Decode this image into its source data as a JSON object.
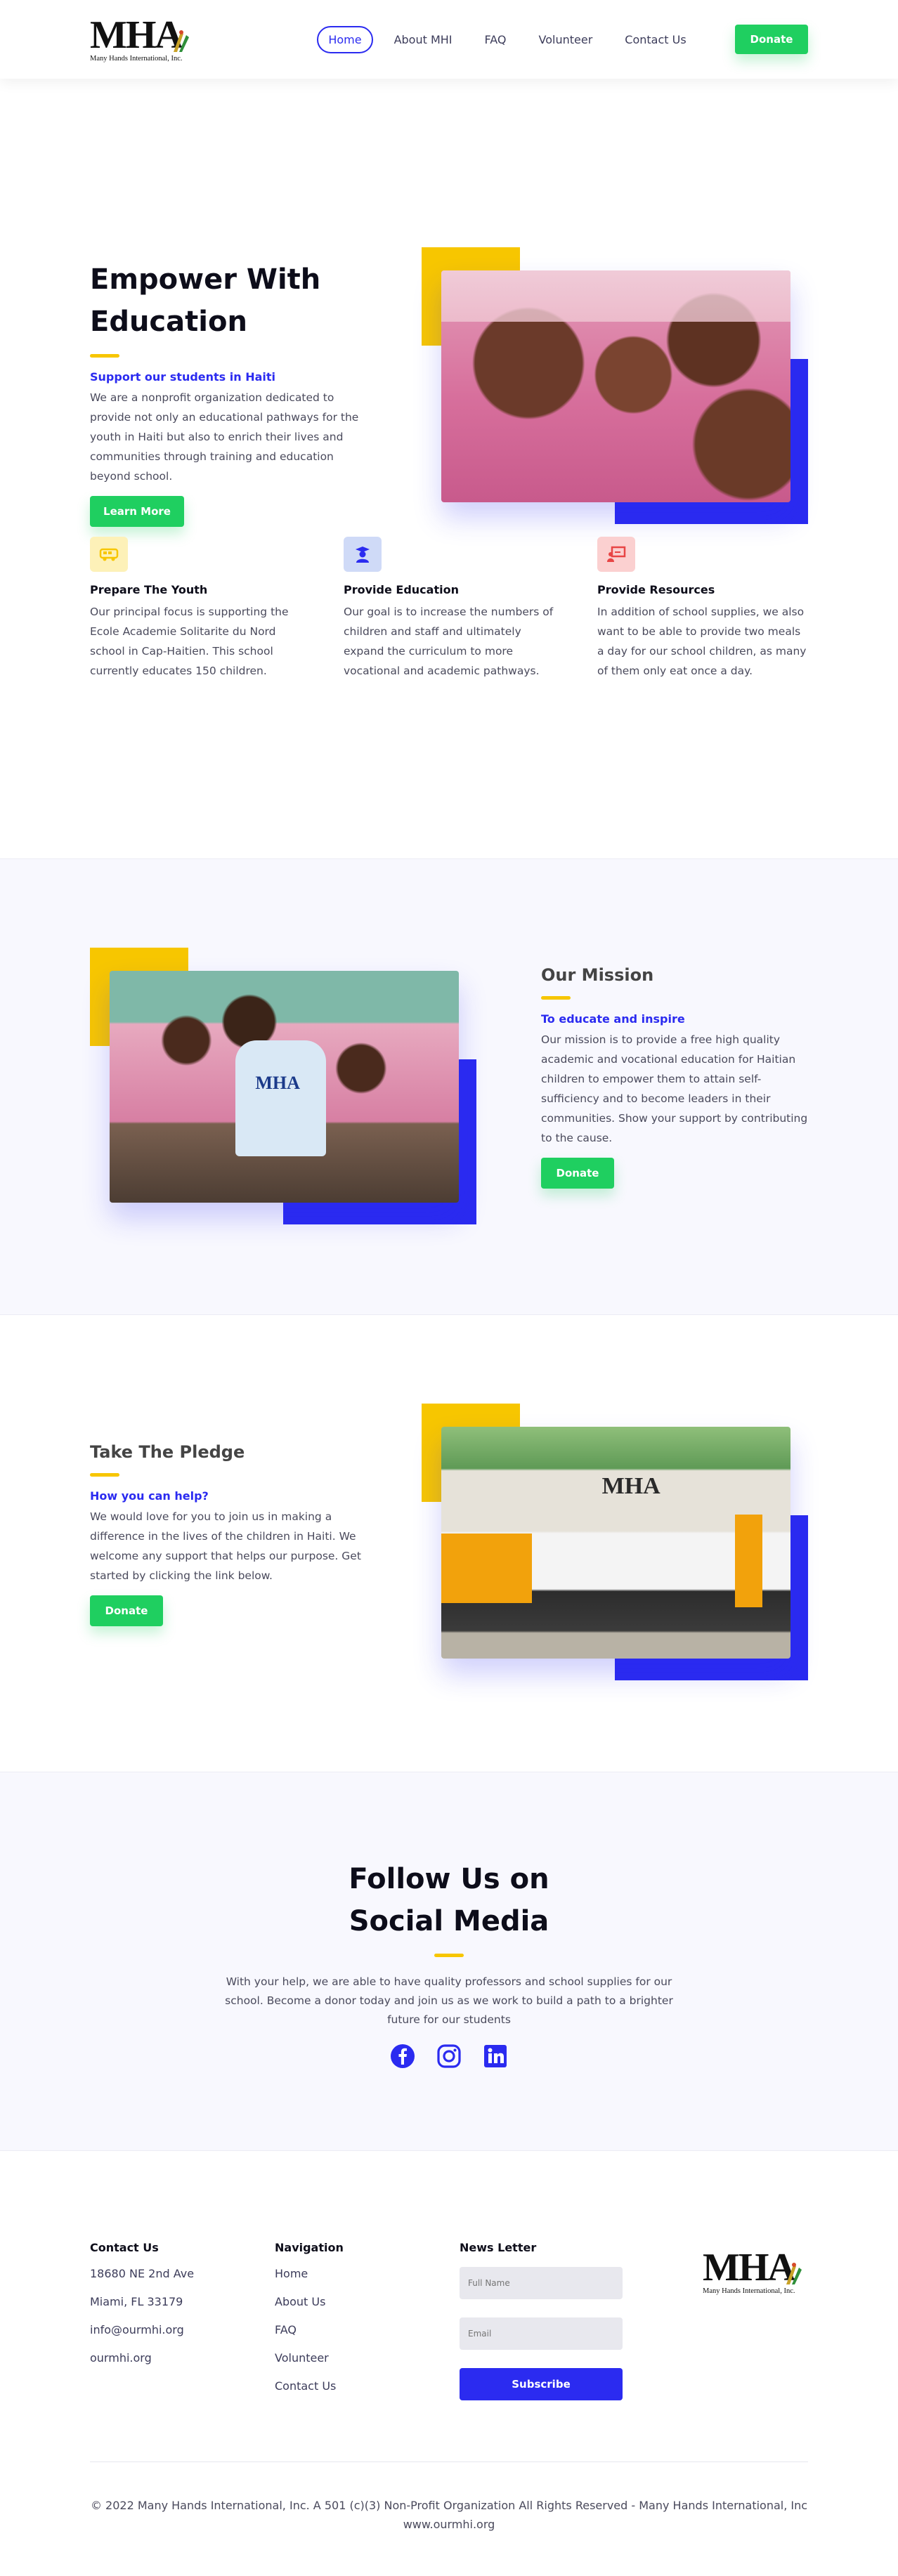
{
  "brand": {
    "logo_text": "MHA",
    "logo_sub": "Many Hands International, Inc."
  },
  "nav": [
    {
      "label": "Home",
      "active": true
    },
    {
      "label": "About MHI"
    },
    {
      "label": "FAQ"
    },
    {
      "label": "Volunteer"
    },
    {
      "label": "Contact Us"
    }
  ],
  "header": {
    "donate_label": "Donate"
  },
  "hero": {
    "title": "Empower With Education",
    "subtitle": "Support our students in Haiti",
    "text": "We are a nonprofit organization dedicated to provide not only an educational pathways for the youth in Haiti but also to enrich their lives and communities through training and education beyond school.",
    "button": "Learn More"
  },
  "features": [
    {
      "icon": "school-bus-icon",
      "color": "#f7c600",
      "title": "Prepare The Youth",
      "text": "Our principal focus is supporting the Ecole Academie Solitarite du Nord school in Cap-Haitien. This school currently educates 150 children."
    },
    {
      "icon": "graduate-icon",
      "color": "#2b2bf0",
      "title": "Provide Education",
      "text": "Our goal is to increase the numbers of children and staff and ultimately expand the curriculum to more vocational and academic pathways."
    },
    {
      "icon": "teacher-board-icon",
      "color": "#e84545",
      "title": "Provide Resources",
      "text": "In addition of school supplies, we also want to be able to provide two meals a day for our school children, as many of them only eat once a day."
    }
  ],
  "mission": {
    "title": "Our Mission",
    "subtitle": "To educate and inspire",
    "text": "Our mission is to provide a free high quality academic and vocational education for Haitian children to empower them to attain self-sufficiency and to become leaders in their communities. Show your support by contributing to the cause.",
    "button": "Donate",
    "shirt_text": "MHA"
  },
  "pledge": {
    "title": "Take The Pledge",
    "subtitle": "How you can help?",
    "text": "We would love for you to join us in making a difference in the lives of the children in Haiti. We welcome any support that helps our purpose. Get started by clicking the link below.",
    "button": "Donate",
    "sign_text": "MHA"
  },
  "social": {
    "title": "Follow Us on Social Media",
    "text": "With your help, we are able to have quality professors and school supplies for our school. Become a donor today and join us as we work to build a path to a brighter future for our students",
    "icons": [
      "facebook-icon",
      "instagram-icon",
      "linkedin-icon"
    ],
    "icon_color": "#2b2bf0"
  },
  "footer": {
    "contact": {
      "heading": "Contact Us",
      "lines": [
        "18680 NE 2nd Ave",
        "Miami, FL 33179",
        "info@ourmhi.org",
        "ourmhi.org"
      ]
    },
    "navigation": {
      "heading": "Navigation",
      "links": [
        "Home",
        "About Us",
        "FAQ",
        "Volunteer",
        "Contact Us"
      ]
    },
    "newsletter": {
      "heading": "News Letter",
      "name_placeholder": "Full Name",
      "email_placeholder": "Email",
      "button": "Subscribe"
    },
    "copyright": "© 2022 Many Hands International, Inc. A 501 (c)(3) Non-Profit Organization All Rights Reserved - Many Hands International, Inc www.ourmhi.org"
  },
  "colors": {
    "accent_blue": "#2b2bf0",
    "accent_yellow": "#f7c600",
    "accent_green": "#1fcf60"
  }
}
